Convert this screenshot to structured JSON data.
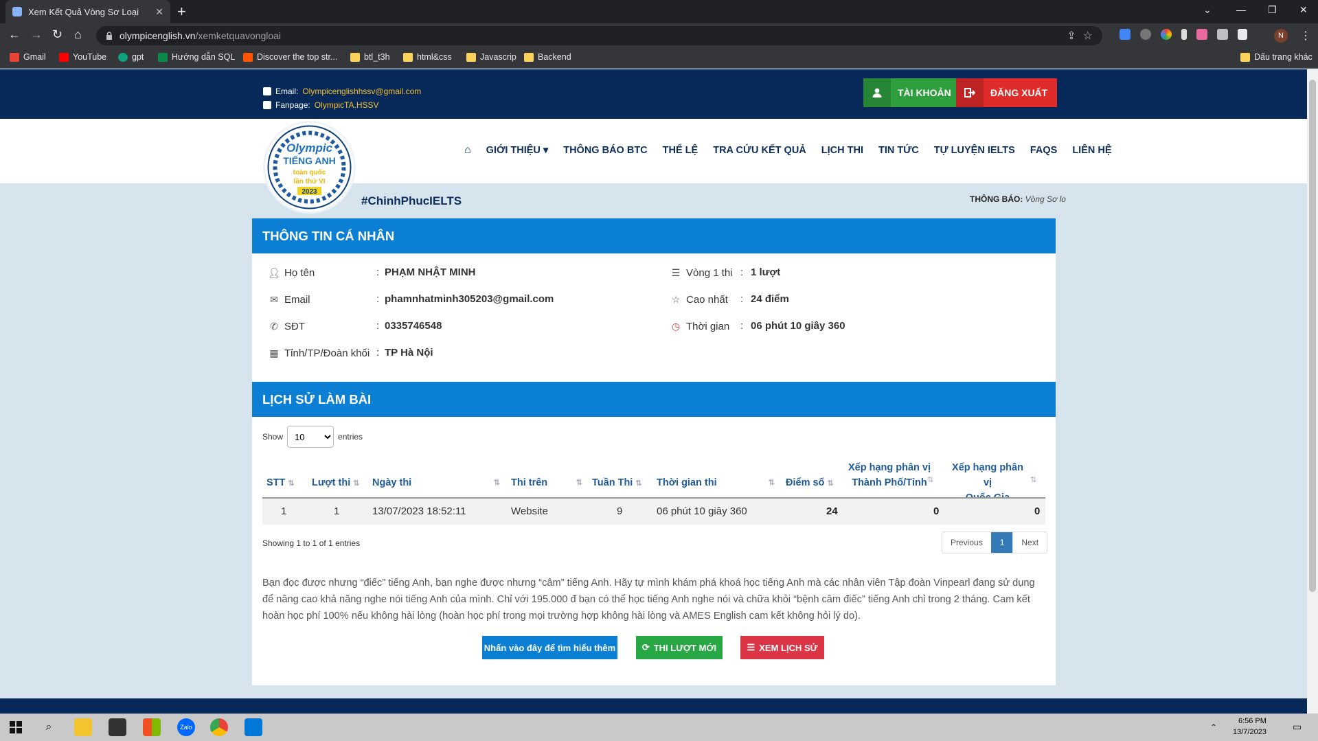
{
  "browser": {
    "tab_title": "Xem Kết Quả Vòng Sơ Loại",
    "url_domain": "olympicenglish.vn",
    "url_path": "/xemketquavongloai",
    "profile_initial": "N",
    "bookmarks": [
      "Gmail",
      "YouTube",
      "gpt",
      "Hướng dẫn SQL",
      "Discover the top str...",
      "btl_t3h",
      "html&css",
      "Javascrip",
      "Backend"
    ],
    "other_bookmarks": "Dấu trang khác"
  },
  "topbar": {
    "email_label": "Email:",
    "email_value": "Olympicenglishhssv@gmail.com",
    "fanpage_label": "Fanpage:",
    "fanpage_value": "OlympicTA.HSSV",
    "account_button": "TÀI KHOẢN",
    "logout_button": "ĐĂNG XUẤT"
  },
  "nav": {
    "items": [
      "GIỚI THIỆU",
      "THÔNG BÁO BTC",
      "THỂ LỆ",
      "TRA CỨU KẾT QUẢ",
      "LỊCH THI",
      "TIN TỨC",
      "TỰ LUYỆN IELTS",
      "FAQS",
      "LIÊN HỆ"
    ],
    "hashtag": "#ChinhPhucIELTS",
    "logo_text": [
      "Olympic",
      "TIẾNG ANH",
      "toàn quốc",
      "lần thứ VI",
      "2023"
    ],
    "notice_label": "THÔNG BÁO:",
    "notice_text": "Vòng Sơ lo"
  },
  "personal": {
    "heading": "THÔNG TIN CÁ NHÂN",
    "fields": [
      {
        "label": "Họ tên",
        "value": "PHẠM NHẬT MINH"
      },
      {
        "label": "Email",
        "value": "phamnhatminh305203@gmail.com"
      },
      {
        "label": "SĐT",
        "value": "0335746548"
      },
      {
        "label": "Tỉnh/TP/Đoàn khối",
        "value": "TP Hà Nội"
      }
    ],
    "stats": [
      {
        "label": "Vòng 1 thi",
        "value": "1 lượt"
      },
      {
        "label": "Cao nhất",
        "value": "24 điểm"
      },
      {
        "label": "Thời gian",
        "value": "06 phút 10 giây 360"
      }
    ],
    "colon": ":"
  },
  "history": {
    "heading": "LỊCH SỬ LÀM BÀI",
    "show_label": "Show",
    "show_value": "10",
    "entries_label": "entries",
    "columns": [
      "STT",
      "Lượt thi",
      "Ngày thi",
      "Thi trên",
      "Tuần Thi",
      "Thời gian thi",
      "Điểm số",
      "Xếp hạng phân vị",
      "Thành Phố/Tỉnh",
      "Xếp hạng phân vị",
      "Quốc Gia"
    ],
    "rows": [
      {
        "stt": "1",
        "luot": "1",
        "ngay": "13/07/2023 18:52:11",
        "tren": "Website",
        "tuan": "9",
        "thoigian": "06 phút 10 giây 360",
        "diem": "24",
        "xh_tinh": "0",
        "xh_qg": "0"
      }
    ],
    "showing": "Showing 1 to 1 of 1 entries",
    "pager": {
      "prev": "Previous",
      "current": "1",
      "next": "Next"
    }
  },
  "promo": {
    "text": "Bạn đọc được nhưng “điếc” tiếng Anh, bạn nghe được nhưng “câm” tiếng Anh. Hãy tự mình khám phá khoá học tiếng Anh mà các nhân viên Tập đoàn Vinpearl đang sử dụng để nâng cao khả năng nghe nói tiếng Anh của mình. Chỉ với 195.000 đ bạn có thể học tiếng Anh nghe nói và chữa khỏi “bệnh câm điếc” tiếng Anh chỉ trong 2 tháng. Cam kết hoàn học phí 100% nếu không hài lòng (hoàn học phí trong mọi trường hợp không hài lòng và AMES English cam kết không hỏi lý do).",
    "btn_learn": "Nhấn vào đây để tìm hiểu thêm",
    "btn_retry": "THI LƯỢT MỚI",
    "btn_history": "XEM LỊCH SỬ"
  },
  "taskbar": {
    "time": "6:56 PM",
    "date": "13/7/2023"
  },
  "colors": {
    "navy": "#06295a",
    "blue": "#0b7fd4",
    "green": "#2e9e3f",
    "red": "#e02b2b",
    "learn": "#0b7fd4",
    "retry": "#28a745",
    "history": "#dc3545"
  }
}
